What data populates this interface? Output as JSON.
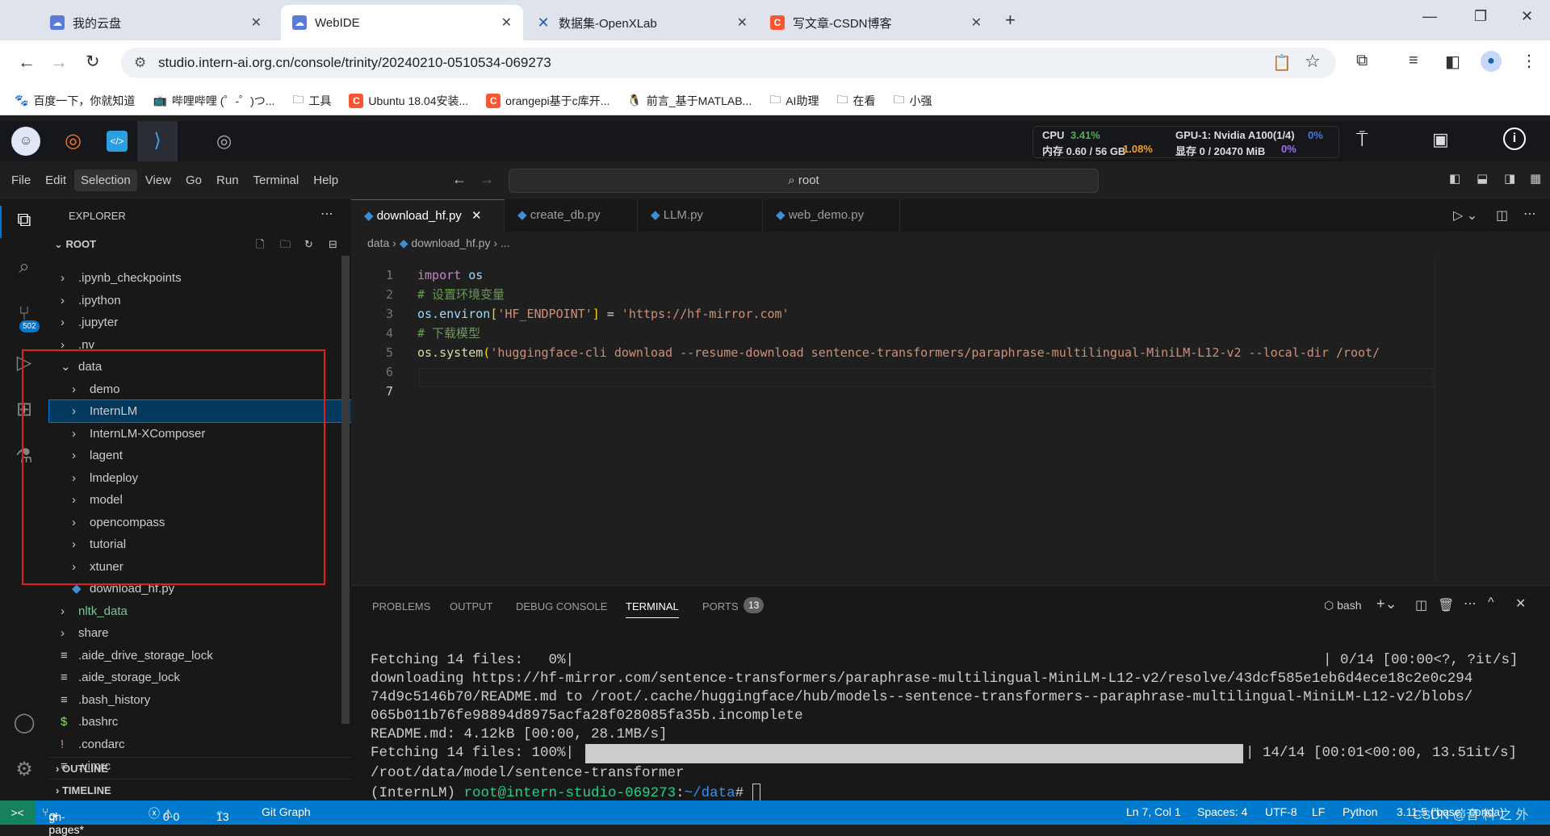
{
  "browser": {
    "tabs": [
      {
        "title": "我的云盘"
      },
      {
        "title": "WebIDE"
      },
      {
        "title": "数据集-OpenXLab"
      },
      {
        "title": "写文章-CSDN博客"
      }
    ],
    "url": "studio.intern-ai.org.cn/console/trinity/20240210-0510534-069273",
    "bookmarks": [
      "百度一下，你就知道",
      "哔哩哔哩 (゜-゜)つ...",
      "工具",
      "Ubuntu 18.04安装...",
      "orangepi基于c库开...",
      "前言_基于MATLAB...",
      "AI助理",
      "在看",
      "小强"
    ]
  },
  "ide_bar": {
    "cpu_label": "CPU",
    "cpu": "3.41%",
    "mem_label": "内存 0.60 / 56 GB",
    "mem": "1.08%",
    "gpu_label": "GPU-1: Nvidia A100(1/4)",
    "gpu": "0%",
    "vram_label": "显存 0 / 20470 MiB",
    "vram": "0%"
  },
  "menu": [
    "File",
    "Edit",
    "Selection",
    "View",
    "Go",
    "Run",
    "Terminal",
    "Help"
  ],
  "search": "root",
  "explorer": {
    "title": "EXPLORER",
    "root": "ROOT",
    "scm_badge": "502",
    "items": [
      {
        "label": ".ipynb_checkpoints",
        "type": "folder",
        "depth": 0
      },
      {
        "label": ".ipython",
        "type": "folder",
        "depth": 0
      },
      {
        "label": ".jupyter",
        "type": "folder",
        "depth": 0
      },
      {
        "label": ".nv",
        "type": "folder",
        "depth": 0
      },
      {
        "label": "data",
        "type": "folder-open",
        "depth": 0
      },
      {
        "label": "demo",
        "type": "folder",
        "depth": 1
      },
      {
        "label": "InternLM",
        "type": "folder",
        "depth": 1
      },
      {
        "label": "InternLM-XComposer",
        "type": "folder",
        "depth": 1
      },
      {
        "label": "lagent",
        "type": "folder",
        "depth": 1
      },
      {
        "label": "lmdeploy",
        "type": "folder",
        "depth": 1
      },
      {
        "label": "model",
        "type": "folder",
        "depth": 1
      },
      {
        "label": "opencompass",
        "type": "folder",
        "depth": 1
      },
      {
        "label": "tutorial",
        "type": "folder",
        "depth": 1
      },
      {
        "label": "xtuner",
        "type": "folder",
        "depth": 1
      },
      {
        "label": "download_hf.py",
        "type": "py",
        "depth": 1
      },
      {
        "label": "nltk_data",
        "type": "folder",
        "depth": 0
      },
      {
        "label": "share",
        "type": "folder",
        "depth": 0
      },
      {
        "label": ".aide_drive_storage_lock",
        "type": "file",
        "depth": 0
      },
      {
        "label": ".aide_storage_lock",
        "type": "file",
        "depth": 0
      },
      {
        "label": ".bash_history",
        "type": "file",
        "depth": 0
      },
      {
        "label": ".bashrc",
        "type": "sh",
        "depth": 0
      },
      {
        "label": ".condarc",
        "type": "excl",
        "depth": 0
      },
      {
        "label": ".vimrc",
        "type": "file",
        "depth": 0
      }
    ],
    "outline": "OUTLINE",
    "timeline": "TIMELINE"
  },
  "editor": {
    "tabs": [
      "download_hf.py",
      "create_db.py",
      "LLM.py",
      "web_demo.py"
    ],
    "breadcrumb": [
      "data",
      "download_hf.py",
      "..."
    ],
    "lines": [
      [
        {
          "t": "import",
          "c": "#c586c0"
        },
        {
          "t": " os",
          "c": "#9cdcfe"
        }
      ],
      [
        {
          "t": "# 设置环境变量",
          "c": "#6a9955"
        }
      ],
      [
        {
          "t": "os.environ",
          "c": "#9cdcfe"
        },
        {
          "t": "[",
          "c": "#ffd700"
        },
        {
          "t": "'HF_ENDPOINT'",
          "c": "#ce9178"
        },
        {
          "t": "]",
          "c": "#ffd700"
        },
        {
          "t": " = ",
          "c": "#d4d4d4"
        },
        {
          "t": "'https://hf-mirror.com'",
          "c": "#ce9178"
        }
      ],
      [
        {
          "t": "# 下载模型",
          "c": "#6a9955"
        }
      ],
      [
        {
          "t": "os.system",
          "c": "#dcdcaa"
        },
        {
          "t": "(",
          "c": "#ffd700"
        },
        {
          "t": "'huggingface-cli download --resume-download sentence-transformers/paraphrase-multilingual-MiniLM-L12-v2 --local-dir /root/",
          "c": "#ce9178"
        }
      ],
      [],
      []
    ]
  },
  "panel": {
    "tabs": [
      "PROBLEMS",
      "OUTPUT",
      "DEBUG CONSOLE",
      "TERMINAL",
      "PORTS"
    ],
    "ports_count": "13",
    "shell": "bash",
    "terminal": [
      "Fetching 14 files:   0%|",
      "downloading https://hf-mirror.com/sentence-transformers/paraphrase-multilingual-MiniLM-L12-v2/resolve/43dcf585e1eb6d4ece18c2e0c294",
      "74d9c5146b70/README.md to /root/.cache/huggingface/hub/models--sentence-transformers--paraphrase-multilingual-MiniLM-L12-v2/blobs/",
      "065b011b76fe98894d8975acfa28f028085fa35b.incomplete",
      "README.md: 4.12kB [00:00, 28.1MB/s]",
      "Fetching 14 files: 100%|",
      "/root/data/model/sentence-transformer"
    ],
    "progress0_right": "| 0/14 [00:00<?, ?it/s]",
    "progress1_right": "| 14/14 [00:01<00:00, 13.51it/s]",
    "progress_fraction": 1.0,
    "prompt_env": "(InternLM) ",
    "prompt_user": "root@intern-studio-069273",
    "prompt_path": "~/data",
    "prompt_end": "# "
  },
  "status": {
    "branch": "gh-pages*",
    "errors": "0",
    "warnings": "0",
    "ports": "13",
    "git_graph": "Git Graph",
    "ln": "Ln 7, Col 1",
    "spaces": "Spaces: 4",
    "enc": "UTF-8",
    "eol": "LF",
    "lang": "Python",
    "interp": "3.11.5 ('base': conda)",
    "watermark": "CSDN @音 料 之 外"
  }
}
